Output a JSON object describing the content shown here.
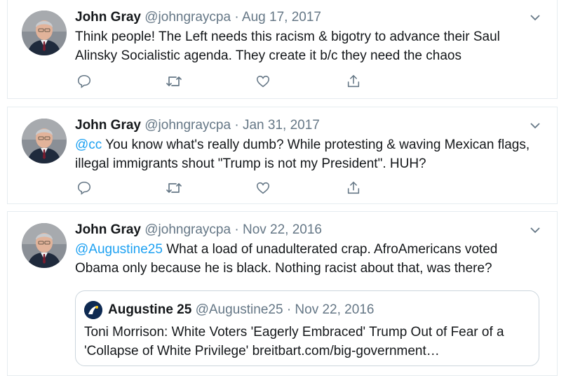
{
  "colors": {
    "link": "#1da1f2",
    "secondary_text": "#657786",
    "primary_text": "#14171a",
    "border": "#e6ecf0"
  },
  "icons": [
    "reply-icon",
    "retweet-icon",
    "like-icon",
    "share-icon",
    "caret-down-icon"
  ],
  "tweets": [
    {
      "author_name": "John Gray",
      "handle": "@johngraycpa",
      "separator": "·",
      "date": "Aug 17, 2017",
      "text": "Think people! The Left needs this racism & bigotry to advance their Saul Alinsky Socialistic agenda. They create it b/c they need the chaos"
    },
    {
      "author_name": "John Gray",
      "handle": "@johngraycpa",
      "separator": "·",
      "date": "Jan 31, 2017",
      "mention": "@cc",
      "text": " You know what's really dumb? While protesting & waving Mexican flags, illegal immigrants shout \"Trump is not my President\". HUH?"
    },
    {
      "author_name": "John Gray",
      "handle": "@johngraycpa",
      "separator": "·",
      "date": "Nov 22, 2016",
      "mention": "@Augustine25",
      "text": " What a load of unadulterated crap. AfroAmericans voted Obama only because he is black. Nothing racist about that, was there?",
      "quoted": {
        "author_name": "Augustine 25",
        "handle": "@Augustine25",
        "separator": "·",
        "date": "Nov 22, 2016",
        "text": "Toni Morrison: White Voters 'Eagerly Embraced' Trump Out of Fear of a 'Collapse of White Privilege' breitbart.com/big-government…"
      }
    }
  ]
}
